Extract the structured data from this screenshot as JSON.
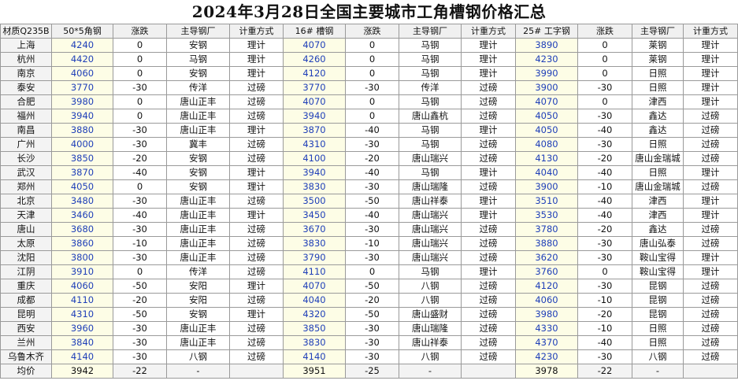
{
  "title": "2024年3月28日全国主要城市工角槽钢价格汇总",
  "headers": [
    "材质Q235B",
    "50*5角钢",
    "涨跌",
    "主导钢厂",
    "计重方式",
    "16# 槽钢",
    "涨跌",
    "主导钢厂",
    "计重方式",
    "25# 工字钢",
    "涨跌",
    "主导钢厂",
    "计重方式"
  ],
  "rows": [
    [
      "上海",
      "4240",
      "0",
      "安钢",
      "理计",
      "4070",
      "0",
      "马钢",
      "理计",
      "3890",
      "0",
      "莱钢",
      "理计"
    ],
    [
      "杭州",
      "4420",
      "0",
      "马钢",
      "理计",
      "4260",
      "0",
      "马钢",
      "理计",
      "4230",
      "0",
      "莱钢",
      "理计"
    ],
    [
      "南京",
      "4060",
      "0",
      "安钢",
      "理计",
      "4120",
      "0",
      "马钢",
      "理计",
      "3990",
      "0",
      "日照",
      "理计"
    ],
    [
      "泰安",
      "3770",
      "-30",
      "传洋",
      "过磅",
      "3770",
      "-30",
      "传洋",
      "过磅",
      "3900",
      "-30",
      "日照",
      "理计"
    ],
    [
      "合肥",
      "3980",
      "0",
      "唐山正丰",
      "过磅",
      "4070",
      "0",
      "马钢",
      "过磅",
      "4070",
      "0",
      "津西",
      "理计"
    ],
    [
      "福州",
      "3940",
      "0",
      "唐山正丰",
      "过磅",
      "3940",
      "0",
      "唐山鑫杭",
      "过磅",
      "4050",
      "-30",
      "鑫达",
      "过磅"
    ],
    [
      "南昌",
      "3880",
      "-30",
      "唐山正丰",
      "理计",
      "3870",
      "-40",
      "马钢",
      "理计",
      "4050",
      "-40",
      "鑫达",
      "过磅"
    ],
    [
      "广州",
      "4000",
      "-30",
      "冀丰",
      "过磅",
      "4310",
      "-30",
      "马钢",
      "过磅",
      "4080",
      "-30",
      "日照",
      "过磅"
    ],
    [
      "长沙",
      "3850",
      "-20",
      "安钢",
      "过磅",
      "4100",
      "-20",
      "唐山瑞兴",
      "过磅",
      "4130",
      "-20",
      "唐山金瑞城",
      "过磅"
    ],
    [
      "武汉",
      "3870",
      "-40",
      "安钢",
      "理计",
      "3940",
      "-40",
      "马钢",
      "理计",
      "4040",
      "-40",
      "日照",
      "理计"
    ],
    [
      "郑州",
      "4050",
      "0",
      "安钢",
      "理计",
      "3830",
      "-30",
      "唐山瑞隆",
      "过磅",
      "3900",
      "-10",
      "唐山金瑞城",
      "过磅"
    ],
    [
      "北京",
      "3480",
      "-30",
      "唐山正丰",
      "过磅",
      "3500",
      "-50",
      "唐山祥泰",
      "理计",
      "3510",
      "-40",
      "津西",
      "理计"
    ],
    [
      "天津",
      "3460",
      "-40",
      "唐山正丰",
      "理计",
      "3450",
      "-40",
      "唐山瑞兴",
      "理计",
      "3530",
      "-40",
      "津西",
      "理计"
    ],
    [
      "唐山",
      "3680",
      "-30",
      "唐山正丰",
      "过磅",
      "3670",
      "-30",
      "唐山瑞兴",
      "过磅",
      "3780",
      "-20",
      "鑫达",
      "过磅"
    ],
    [
      "太原",
      "3860",
      "-10",
      "唐山正丰",
      "过磅",
      "3830",
      "-10",
      "唐山瑞兴",
      "过磅",
      "3880",
      "-30",
      "唐山弘泰",
      "过磅"
    ],
    [
      "沈阳",
      "3800",
      "-30",
      "唐山正丰",
      "过磅",
      "3790",
      "-30",
      "唐山瑞兴",
      "过磅",
      "3620",
      "-30",
      "鞍山宝得",
      "理计"
    ],
    [
      "江阴",
      "3910",
      "0",
      "传洋",
      "过磅",
      "4110",
      "0",
      "马钢",
      "理计",
      "3760",
      "0",
      "鞍山宝得",
      "理计"
    ],
    [
      "重庆",
      "4060",
      "-50",
      "安阳",
      "理计",
      "4070",
      "-50",
      "八钢",
      "过磅",
      "4120",
      "-30",
      "昆钢",
      "过磅"
    ],
    [
      "成都",
      "4110",
      "-20",
      "安阳",
      "过磅",
      "4040",
      "-20",
      "八钢",
      "过磅",
      "4060",
      "-10",
      "昆钢",
      "过磅"
    ],
    [
      "昆明",
      "4310",
      "-50",
      "安钢",
      "理计",
      "4320",
      "-50",
      "唐山盛财",
      "过磅",
      "3980",
      "-20",
      "昆钢",
      "过磅"
    ],
    [
      "西安",
      "3960",
      "-30",
      "唐山正丰",
      "过磅",
      "3850",
      "-30",
      "唐山瑞隆",
      "过磅",
      "4330",
      "-10",
      "日照",
      "过磅"
    ],
    [
      "兰州",
      "3840",
      "-30",
      "唐山正丰",
      "过磅",
      "3830",
      "-30",
      "唐山祥泰",
      "过磅",
      "4370",
      "-40",
      "日照",
      "过磅"
    ],
    [
      "乌鲁木齐",
      "4140",
      "-30",
      "八钢",
      "过磅",
      "4140",
      "-30",
      "八钢",
      "过磅",
      "4230",
      "-30",
      "八钢",
      "过磅"
    ]
  ],
  "average": [
    "均价",
    "3942",
    "-22",
    "-",
    "",
    "3951",
    "-25",
    "-",
    "",
    "3978",
    "-22",
    "-",
    ""
  ]
}
